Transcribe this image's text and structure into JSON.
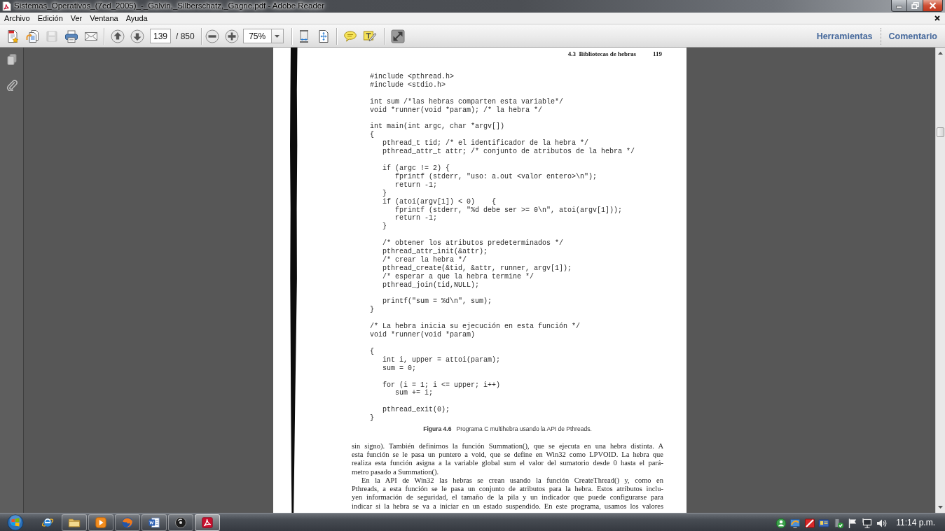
{
  "window": {
    "title": "Sistemas_Operativos_(7ed_2005)_-_Galvin,_Silberschatz,_Gagne.pdf - Adobe Reader"
  },
  "menu": [
    "Archivo",
    "Edición",
    "Ver",
    "Ventana",
    "Ayuda"
  ],
  "toolbar": {
    "file_buttons": [
      {
        "kind": "create",
        "disabled": false
      },
      {
        "kind": "combine",
        "disabled": false
      },
      {
        "kind": "save",
        "disabled": true
      },
      {
        "kind": "print",
        "disabled": false
      },
      {
        "kind": "email",
        "disabled": false
      }
    ],
    "page_buttons": [
      {
        "kind": "previous"
      },
      {
        "kind": "next"
      }
    ],
    "page_number": "139",
    "page_count": "/ 850",
    "zoom_buttons": [
      {
        "kind": "zoom_out"
      },
      {
        "kind": "zoom_in"
      }
    ],
    "zoom": "75%",
    "view_buttons": [
      {
        "kind": "fit_width"
      },
      {
        "kind": "fit_page"
      }
    ],
    "comment_buttons": [
      {
        "kind": "note"
      },
      {
        "kind": "highlight"
      }
    ],
    "screen_buttons": [
      {
        "kind": "full_screen"
      }
    ],
    "panel_links": [
      "Herramientas",
      "Comentario"
    ]
  },
  "nav_panel": [
    {
      "kind": "pages"
    },
    {
      "kind": "attachments"
    }
  ],
  "document": {
    "running_head": "4.3  Bibliotecas de hebras",
    "page_number": "119",
    "code": "#include <pthread.h>\n#include <stdio.h>\n\nint sum /*las hebras comparten esta variable*/\nvoid *runner(void *param); /* la hebra */\n\nint main(int argc, char *argv[])\n{\n   pthread_t tid; /* el identificador de la hebra */\n   pthread_attr_t attr; /* conjunto de atributos de la hebra */\n\n   if (argc != 2) {\n      fprintf (stderr, \"uso: a.out <valor entero>\\n\");\n      return -1;\n   }\n   if (atoi(argv[1]) < 0)    {\n      fprintf (stderr, \"%d debe ser >= 0\\n\", atoi(argv[1]));\n      return -1;\n   }\n\n   /* obtener los atributos predeterminados */\n   pthread_attr_init(&attr);\n   /* crear la hebra */\n   pthread_create(&tid, &attr, runner, argv[1]);\n   /* esperar a que la hebra termine */\n   pthread_join(tid,NULL);\n\n   printf(\"sum = %d\\n\", sum);\n}\n\n/* La hebra inicia su ejecución en esta función */\nvoid *runner(void *param)\n\n{\n   int i, upper = attoi(param);\n   sum = 0;\n\n   for (i = 1; i <= upper; i++)\n      sum += i;\n\n   pthread_exit(0);\n}",
    "caption": "**Figura 4.6**   Programa C multihebra usando la API de Pthreads.",
    "paragraphs": [
      {
        "indent": false,
        "ends": true,
        "lines": [
          "sin signo). También definimos la función Summation(), que se ejecuta en una hebra distinta. A",
          "esta función se le pasa un puntero a void, que se define en Win32 como LPVOID. La hebra que",
          "realiza esta función asigna a la variable global sum el valor del sumatorio desde 0 hasta el pará-",
          "metro pasado a Summation()."
        ]
      },
      {
        "indent": true,
        "ends": false,
        "lines": [
          "En la API de Win32 las hebras se crean usando la función CreateThread() y, como en",
          "Pthreads, a esta función se le pasa un conjunto de atributos para la hebra. Estos atributos inclu-",
          "yen información de seguridad, el tamaño de la pila y un indicador que puede configurarse para",
          "indicar si la hebra se va a iniciar en un estado suspendido. En este programa, usamos los valores"
        ]
      }
    ]
  },
  "taskbar": {
    "apps": [
      {
        "kind": "browser",
        "running": false,
        "selected": false
      },
      {
        "kind": "folder",
        "running": true,
        "selected": false
      },
      {
        "kind": "player",
        "running": true,
        "selected": false
      },
      {
        "kind": "globe",
        "running": true,
        "selected": false
      },
      {
        "kind": "writer",
        "running": true,
        "selected": false
      },
      {
        "kind": "disc",
        "running": true,
        "selected": false
      },
      {
        "kind": "pdf",
        "running": true,
        "selected": true
      }
    ],
    "clock": "11:14 p.m."
  }
}
